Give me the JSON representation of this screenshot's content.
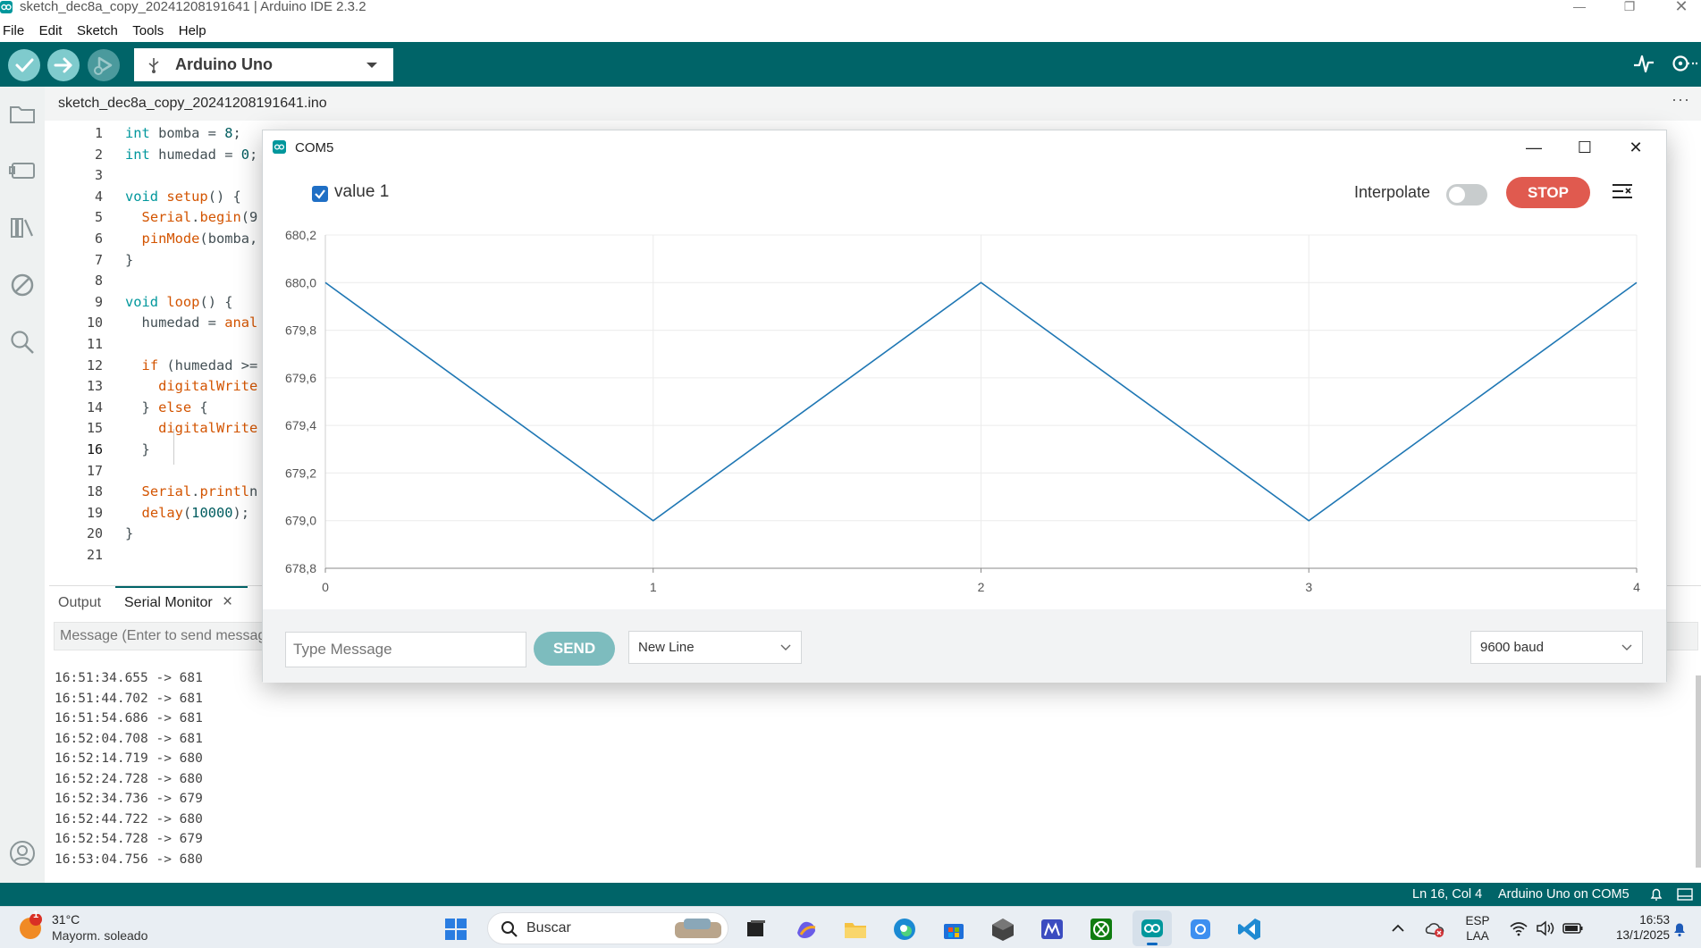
{
  "window": {
    "title": "sketch_dec8a_copy_20241208191641 | Arduino IDE 2.3.2"
  },
  "menu": [
    "File",
    "Edit",
    "Sketch",
    "Tools",
    "Help"
  ],
  "toolbar": {
    "board": "Arduino Uno",
    "icons": [
      "verify-icon",
      "upload-icon",
      "debug-icon",
      "serial-plotter-icon",
      "serial-monitor-icon"
    ]
  },
  "editor": {
    "file_tab": "sketch_dec8a_copy_20241208191641.ino",
    "more": "···",
    "line_numbers": [
      "1",
      "2",
      "3",
      "4",
      "5",
      "6",
      "7",
      "8",
      "9",
      "10",
      "11",
      "12",
      "13",
      "14",
      "15",
      "16",
      "17",
      "18",
      "19",
      "20",
      "21"
    ],
    "current_line": "16",
    "code": [
      {
        "segs": [
          {
            "t": "int",
            "c": "kw"
          },
          {
            "t": " bomba = "
          },
          {
            "t": "8",
            "c": "num"
          },
          {
            "t": ";"
          }
        ]
      },
      {
        "segs": [
          {
            "t": "int",
            "c": "kw"
          },
          {
            "t": " humedad = "
          },
          {
            "t": "0",
            "c": "num"
          },
          {
            "t": ";"
          }
        ]
      },
      {
        "segs": []
      },
      {
        "segs": [
          {
            "t": "void",
            "c": "kw"
          },
          {
            "t": " "
          },
          {
            "t": "setup",
            "c": "fn"
          },
          {
            "t": "() {"
          }
        ]
      },
      {
        "segs": [
          {
            "t": "  "
          },
          {
            "t": "Serial",
            "c": "fn"
          },
          {
            "t": "."
          },
          {
            "t": "begin",
            "c": "fn"
          },
          {
            "t": "(9"
          }
        ]
      },
      {
        "segs": [
          {
            "t": "  "
          },
          {
            "t": "pinMode",
            "c": "fn"
          },
          {
            "t": "(bomba,"
          }
        ]
      },
      {
        "segs": [
          {
            "t": "}"
          }
        ]
      },
      {
        "segs": []
      },
      {
        "segs": [
          {
            "t": "void",
            "c": "kw"
          },
          {
            "t": " "
          },
          {
            "t": "loop",
            "c": "fn"
          },
          {
            "t": "() {"
          }
        ]
      },
      {
        "segs": [
          {
            "t": "  humedad = "
          },
          {
            "t": "anal",
            "c": "fn"
          }
        ]
      },
      {
        "segs": []
      },
      {
        "segs": [
          {
            "t": "  "
          },
          {
            "t": "if",
            "c": "fn"
          },
          {
            "t": " (humedad >="
          }
        ]
      },
      {
        "segs": [
          {
            "t": "    "
          },
          {
            "t": "digitalWrite",
            "c": "fn"
          }
        ]
      },
      {
        "segs": [
          {
            "t": "  } "
          },
          {
            "t": "else",
            "c": "fn"
          },
          {
            "t": " {"
          }
        ]
      },
      {
        "segs": [
          {
            "t": "    "
          },
          {
            "t": "digitalWrite",
            "c": "fn"
          }
        ]
      },
      {
        "segs": [
          {
            "t": "  }"
          }
        ]
      },
      {
        "segs": []
      },
      {
        "segs": [
          {
            "t": "  "
          },
          {
            "t": "Serial",
            "c": "fn"
          },
          {
            "t": "."
          },
          {
            "t": "printl",
            "c": "fn"
          },
          {
            "t": "n"
          }
        ]
      },
      {
        "segs": [
          {
            "t": "  "
          },
          {
            "t": "delay",
            "c": "fn"
          },
          {
            "t": "("
          },
          {
            "t": "10000",
            "c": "num"
          },
          {
            "t": ");"
          }
        ]
      },
      {
        "segs": [
          {
            "t": "}"
          }
        ]
      },
      {
        "segs": []
      }
    ]
  },
  "panel": {
    "tabs": [
      "Output",
      "Serial Monitor"
    ],
    "close": "×",
    "message_placeholder": "Message (Enter to send message to 'Arduino Uno' on 'COM5')",
    "lines": [
      "16:51:34.655 -> 681",
      "16:51:44.702 -> 681",
      "16:51:54.686 -> 681",
      "16:52:04.708 -> 681",
      "16:52:14.719 -> 680",
      "16:52:24.728 -> 680",
      "16:52:34.736 -> 679",
      "16:52:44.722 -> 680",
      "16:52:54.728 -> 679",
      "16:53:04.756 -> 680"
    ]
  },
  "statusbar": {
    "position": "Ln 16, Col 4",
    "board_port": "Arduino Uno on COM5"
  },
  "plotter": {
    "title": "COM5",
    "legend_label": "value 1",
    "legend_color": "#1f6fc5",
    "interpolate_label": "Interpolate",
    "interpolate_on": false,
    "stop_label": "STOP",
    "message_placeholder": "Type Message",
    "send_label": "SEND",
    "line_ending": "New Line",
    "baud": "9600 baud",
    "line_color": "#1f77b4",
    "stop_color": "#e05a4f"
  },
  "chart_data": {
    "type": "line",
    "x": [
      0,
      1,
      2,
      3,
      4
    ],
    "series": [
      {
        "name": "value 1",
        "values": [
          680.0,
          679.0,
          680.0,
          679.0,
          680.0
        ]
      }
    ],
    "yticks": [
      "680,2",
      "680,0",
      "679,8",
      "679,6",
      "679,4",
      "679,2",
      "679,0",
      "678,8"
    ],
    "ytick_values": [
      680.2,
      680.0,
      679.8,
      679.6,
      679.4,
      679.2,
      679.0,
      678.8
    ],
    "xticks": [
      "0",
      "1",
      "2",
      "3",
      "4"
    ],
    "ylim": [
      678.8,
      680.2
    ],
    "xlim": [
      0,
      4
    ],
    "grid": true
  },
  "taskbar": {
    "weather_temp": "31°C",
    "weather_cond": "Mayorm. soleado",
    "weather_badge": "1",
    "search_label": "Buscar",
    "lang_top": "ESP",
    "lang_bottom": "LAA",
    "time": "16:53",
    "date": "13/1/2025"
  }
}
